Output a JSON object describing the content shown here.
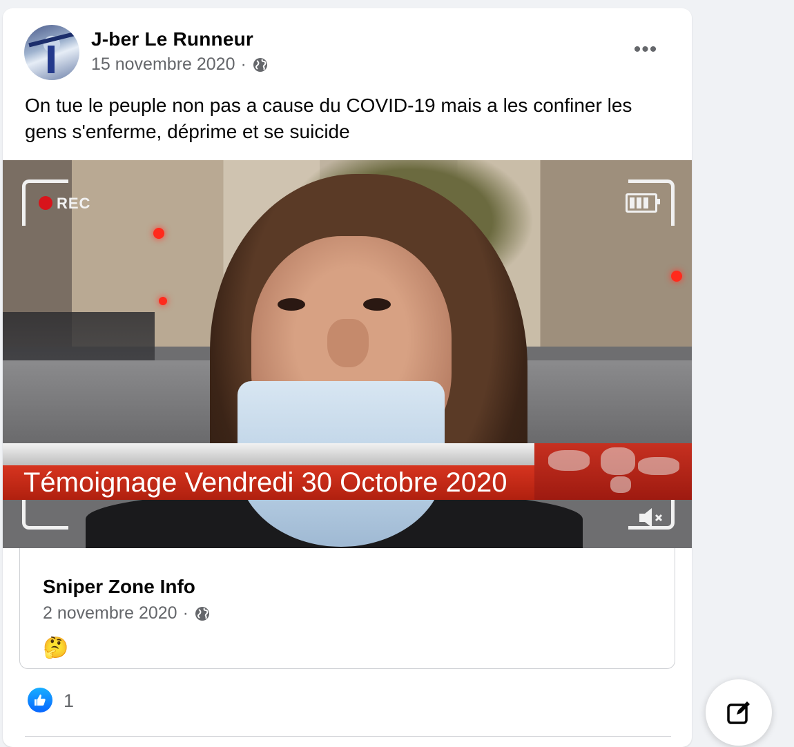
{
  "post": {
    "author": "J-ber Le Runneur",
    "date": "15 novembre 2020",
    "separator": "·",
    "privacy_icon": "globe-icon",
    "more_label": "•••",
    "text": "On tue le peuple non pas a cause du COVID-19 mais a les confiner les gens s'enferme, déprime et se suicide"
  },
  "video": {
    "rec_label": "REC",
    "ticker_text": "Témoignage Vendredi 30 Octobre 2020",
    "icons": [
      "battery-icon",
      "mute-icon"
    ],
    "colors": {
      "ticker": "#c92a16",
      "rec": "#d8141b"
    }
  },
  "shared_post": {
    "author": "Sniper Zone Info",
    "date": "2 novembre 2020",
    "separator": "·",
    "privacy_icon": "globe-icon",
    "emoji": "🤔"
  },
  "reactions": {
    "icon": "like-icon",
    "count": "1",
    "accent": "#0866ff"
  },
  "compose": {
    "icon": "edit-icon"
  }
}
